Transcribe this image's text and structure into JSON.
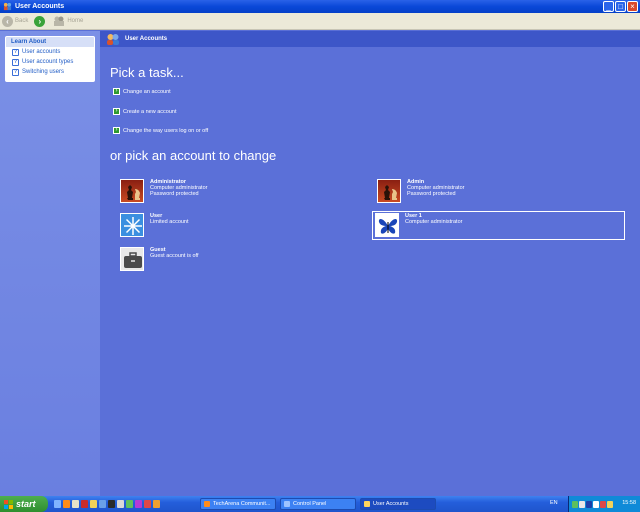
{
  "window": {
    "title": "User Accounts"
  },
  "toolbar": {
    "back_label": "Back",
    "home_label": "Home"
  },
  "learn_about": {
    "header": "Learn About",
    "items": [
      {
        "label": "User accounts"
      },
      {
        "label": "User account types"
      },
      {
        "label": "Switching users"
      }
    ]
  },
  "main": {
    "header_title": "User Accounts",
    "pick_task_heading": "Pick a task...",
    "tasks": [
      {
        "label": "Change an account"
      },
      {
        "label": "Create a new account"
      },
      {
        "label": "Change the way users log on or off"
      }
    ],
    "pick_account_heading": "or pick an account to change",
    "accounts": [
      {
        "name": "Administrator",
        "line1": "Computer administrator",
        "line2": "Password protected",
        "picture": "chess"
      },
      {
        "name": "Admin",
        "line1": "Computer administrator",
        "line2": "Password protected",
        "picture": "chess"
      },
      {
        "name": "User",
        "line1": "Limited account",
        "line2": "",
        "picture": "snowflake"
      },
      {
        "name": "User 1",
        "line1": "Computer administrator",
        "line2": "",
        "picture": "butterfly"
      },
      {
        "name": "Guest",
        "line1": "Guest account is off",
        "line2": "",
        "picture": "briefcase"
      }
    ]
  },
  "taskbar": {
    "start_label": "start",
    "buttons": [
      {
        "label": "TechArena Communit..."
      },
      {
        "label": "Control Panel"
      },
      {
        "label": "User Accounts"
      }
    ],
    "language": "EN",
    "clock": "15:58"
  },
  "colors": {
    "background": "#5b70d8",
    "header": "#3d56c8",
    "link": "#215dc6",
    "taskbar": "#245edb"
  }
}
